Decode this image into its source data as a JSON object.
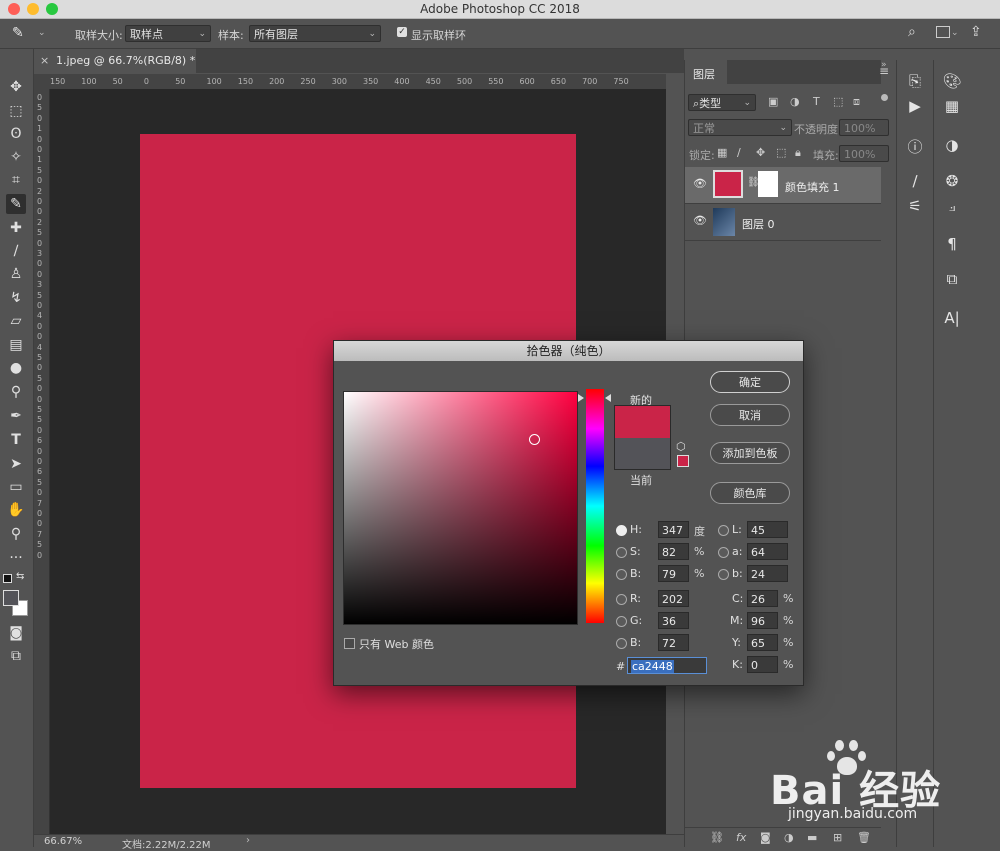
{
  "window": {
    "title": "Adobe Photoshop CC 2018"
  },
  "options_bar": {
    "sample_size_label": "取样大小:",
    "sample_size_value": "取样点",
    "sample_label": "样本:",
    "sample_value": "所有图层",
    "show_ring_label": "显示取样环"
  },
  "document": {
    "tab_label": "1.jpeg @ 66.7%(RGB/8) *",
    "zoom": "66.67%",
    "doc_size": "文档:2.22M/2.22M",
    "fill_color": "#ca2448",
    "ruler_top": [
      "150",
      "100",
      "50",
      "0",
      "50",
      "100",
      "150",
      "200",
      "250",
      "300",
      "350",
      "400",
      "450",
      "500",
      "550",
      "600",
      "650",
      "700",
      "750"
    ],
    "ruler_left": [
      "0",
      "5",
      "0",
      "1",
      "0",
      "0",
      "1",
      "5",
      "0",
      "2",
      "0",
      "0",
      "2",
      "5",
      "0",
      "3",
      "0",
      "0",
      "3",
      "5",
      "0",
      "4",
      "0",
      "0",
      "4",
      "5",
      "0",
      "5",
      "0",
      "0",
      "5",
      "5",
      "0",
      "6",
      "0",
      "0",
      "6",
      "5",
      "0",
      "7",
      "0",
      "0",
      "7",
      "5",
      "0"
    ]
  },
  "layers_panel": {
    "tab": "图层",
    "filter_kind": "类型",
    "blend_mode": "正常",
    "opacity_label": "不透明度:",
    "opacity_value": "100%",
    "lock_label": "锁定:",
    "fill_label": "填充:",
    "fill_value": "100%",
    "layers": [
      {
        "name": "颜色填充 1"
      },
      {
        "name": "图层 0"
      }
    ]
  },
  "color_picker": {
    "title": "拾色器（纯色）",
    "new_label": "新的",
    "current_label": "当前",
    "new_color": "#ca2448",
    "current_color": "#535358",
    "buttons": {
      "ok": "确定",
      "cancel": "取消",
      "add_swatch": "添加到色板",
      "libraries": "颜色库"
    },
    "web_only_label": "只有 Web 颜色",
    "hsb": [
      {
        "label": "H:",
        "value": "347",
        "unit": "度",
        "selected": true
      },
      {
        "label": "S:",
        "value": "82",
        "unit": "%",
        "selected": false
      },
      {
        "label": "B:",
        "value": "79",
        "unit": "%",
        "selected": false
      }
    ],
    "rgb": [
      {
        "label": "R:",
        "value": "202"
      },
      {
        "label": "G:",
        "value": "36"
      },
      {
        "label": "B:",
        "value": "72"
      }
    ],
    "lab": [
      {
        "label": "L:",
        "value": "45"
      },
      {
        "label": "a:",
        "value": "64"
      },
      {
        "label": "b:",
        "value": "24"
      }
    ],
    "cmyk": [
      {
        "label": "C:",
        "value": "26",
        "unit": "%"
      },
      {
        "label": "M:",
        "value": "96",
        "unit": "%"
      },
      {
        "label": "Y:",
        "value": "65",
        "unit": "%"
      },
      {
        "label": "K:",
        "value": "0",
        "unit": "%"
      }
    ],
    "hex_label": "#",
    "hex_value": "ca2448"
  },
  "watermark": {
    "brand": "Bai 经验",
    "url": "jingyan.baidu.com"
  }
}
